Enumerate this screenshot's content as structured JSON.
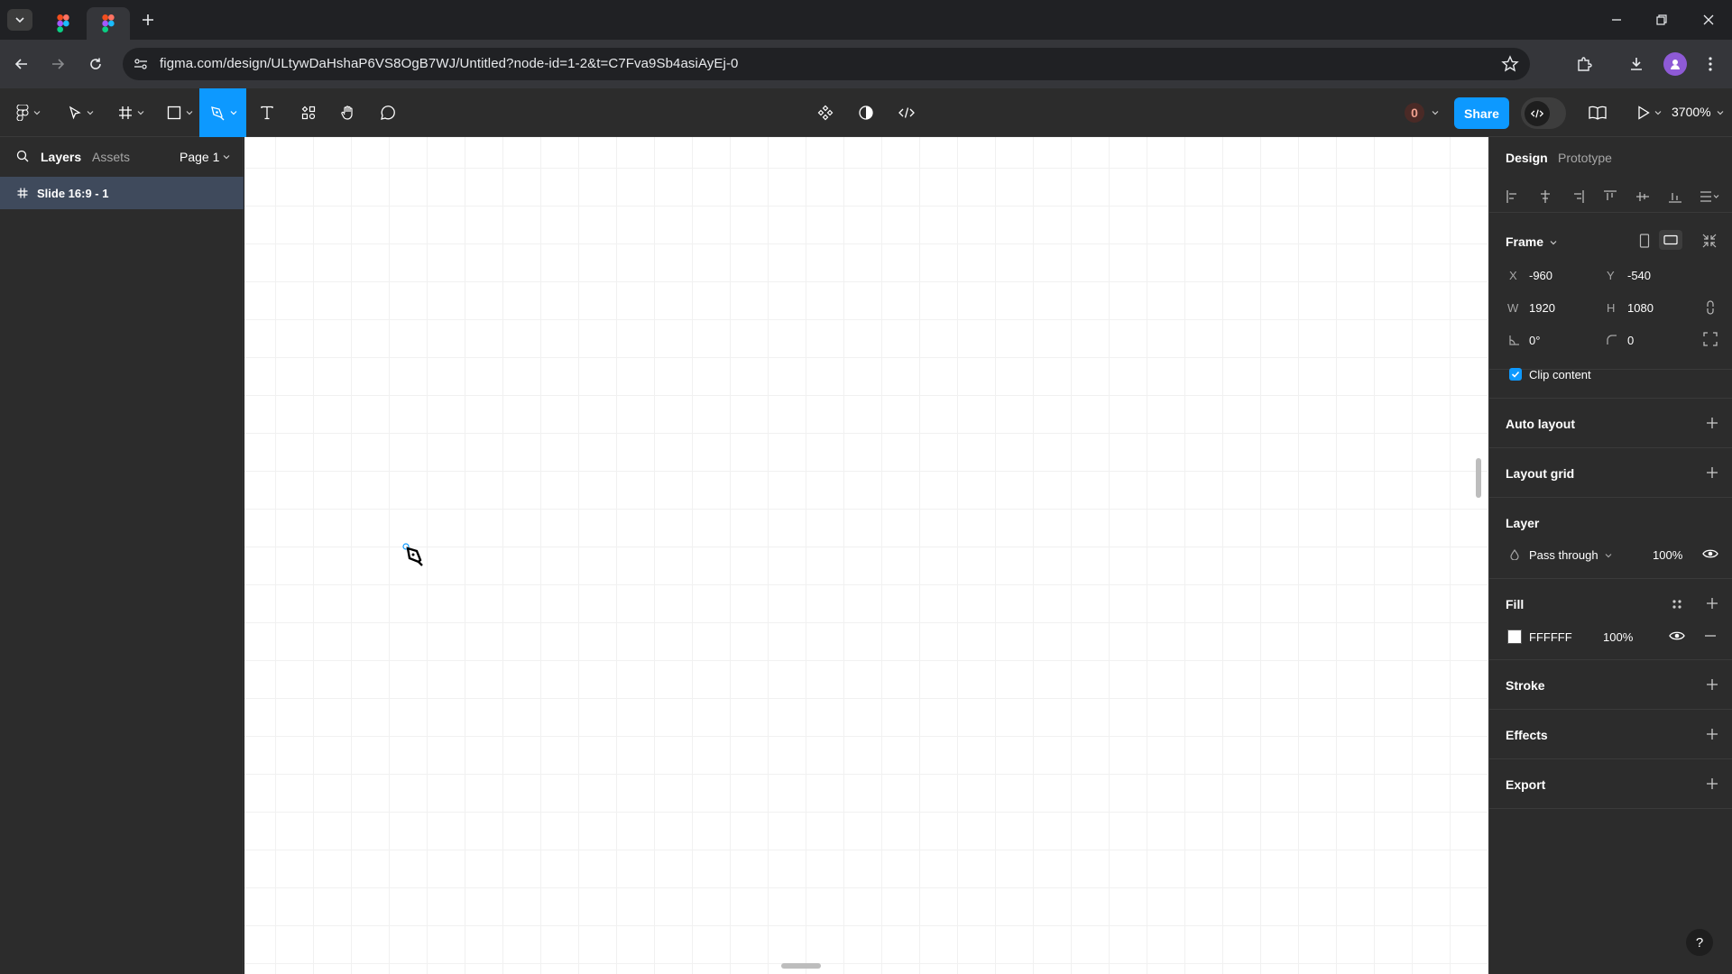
{
  "browser": {
    "url": "figma.com/design/ULtywDaHshaP6VS8OgB7WJ/Untitled?node-id=1-2&t=C7Fva9Sb4asiAyEj-0"
  },
  "toolbar": {
    "counter": "0",
    "share_label": "Share",
    "zoom": "3700%"
  },
  "left_panel": {
    "tabs": [
      "Layers",
      "Assets"
    ],
    "page": "Page 1",
    "layers": [
      {
        "name": "Slide 16:9 - 1"
      }
    ]
  },
  "right_panel": {
    "tabs": [
      "Design",
      "Prototype"
    ],
    "frame": {
      "title": "Frame",
      "x_label": "X",
      "x": "-960",
      "y_label": "Y",
      "y": "-540",
      "w_label": "W",
      "w": "1920",
      "h_label": "H",
      "h": "1080",
      "rotation": "0°",
      "radius": "0",
      "clip_content_label": "Clip content",
      "clip_content": true
    },
    "auto_layout": "Auto layout",
    "layout_grid": "Layout grid",
    "layer": {
      "title": "Layer",
      "blend": "Pass through",
      "opacity": "100%"
    },
    "fill": {
      "title": "Fill",
      "color": "FFFFFF",
      "opacity": "100%"
    },
    "stroke": "Stroke",
    "effects": "Effects",
    "export": "Export",
    "help": "?"
  },
  "colors": {
    "accent": "#0d99ff",
    "panel": "#2c2c2c",
    "fill_swatch": "#ffffff"
  }
}
